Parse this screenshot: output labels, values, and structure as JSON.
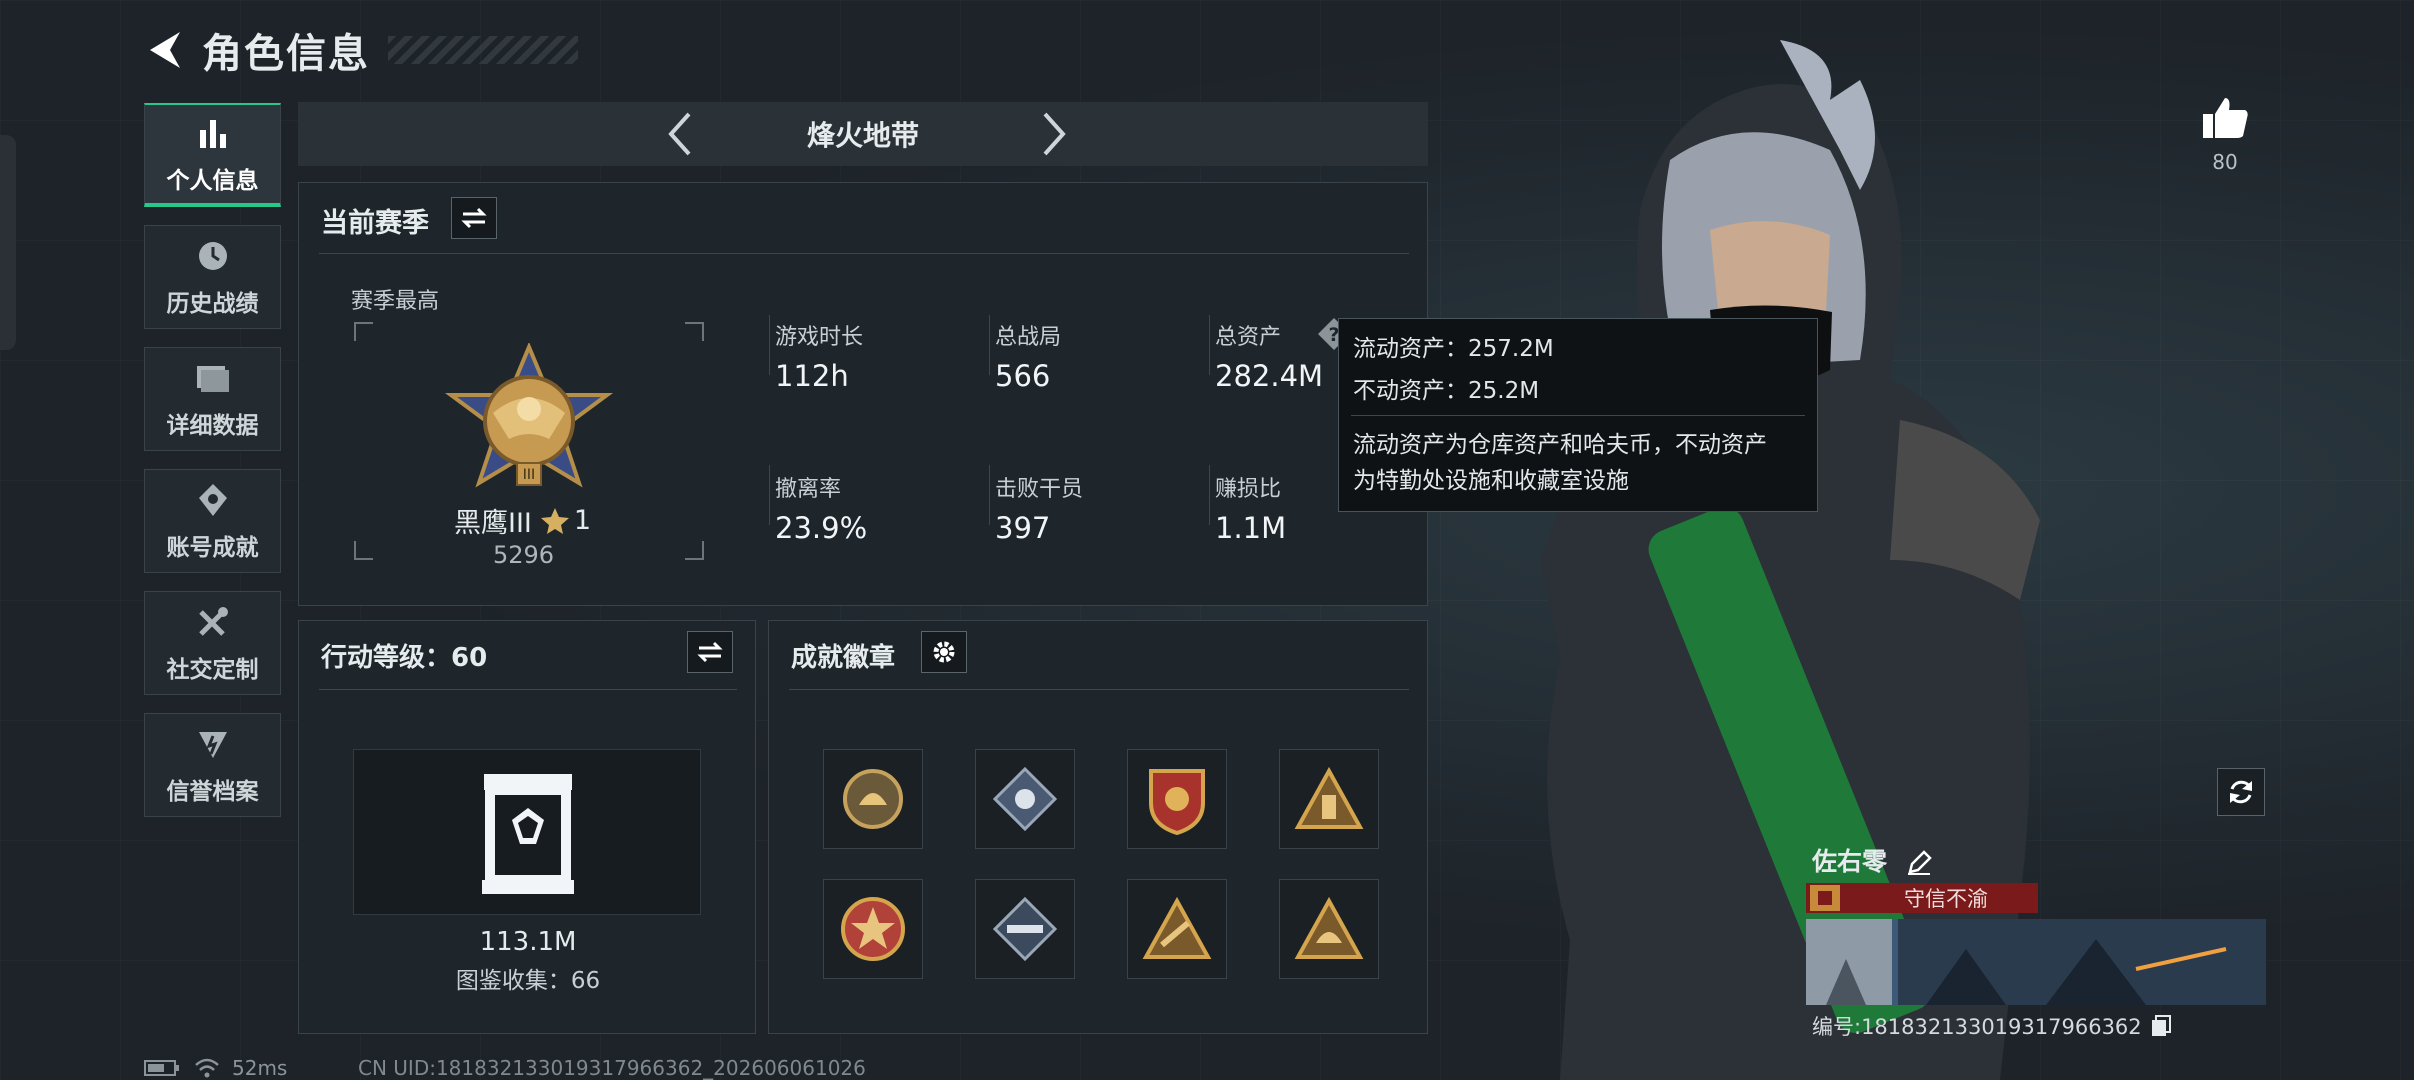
{
  "header": {
    "title": "角色信息"
  },
  "nav": {
    "items": [
      {
        "label": "个人信息",
        "icon": "bar-chart-icon",
        "active": true
      },
      {
        "label": "历史战绩",
        "icon": "clock-icon",
        "active": false
      },
      {
        "label": "详细数据",
        "icon": "folder-icon",
        "active": false
      },
      {
        "label": "账号成就",
        "icon": "achievement-icon",
        "active": false
      },
      {
        "label": "社交定制",
        "icon": "tools-icon",
        "active": false
      },
      {
        "label": "信誉档案",
        "icon": "shield-badge-icon",
        "active": false
      }
    ]
  },
  "mode": {
    "title": "烽火地带"
  },
  "season": {
    "title": "当前赛季",
    "best_label": "赛季最高",
    "rank_name": "黑鹰III",
    "rank_stars": "1",
    "rank_points": "5296",
    "stats": [
      {
        "label": "游戏时长",
        "value": "112h"
      },
      {
        "label": "总战局",
        "value": "566"
      },
      {
        "label": "总资产",
        "value": "282.4M"
      },
      {
        "label": "撤离率",
        "value": "23.9%"
      },
      {
        "label": "击败干员",
        "value": "397"
      },
      {
        "label": "赚损比",
        "value": "1.1M"
      }
    ]
  },
  "tooltip": {
    "liquid": "流动资产：257.2M",
    "fixed": "不动资产：25.2M",
    "desc_line1": "流动资产为仓库资产和哈夫币，不动资产",
    "desc_line2": "为特勤处设施和收藏室设施"
  },
  "level": {
    "title": "行动等级：60",
    "value": "113.1M",
    "collection": "图鉴收集：66"
  },
  "badges": {
    "title": "成就徽章",
    "items": [
      "badge-helmet-icon",
      "badge-flower-icon",
      "badge-shield-icon",
      "badge-soldiers-icon",
      "badge-star-icon",
      "badge-rifle-icon",
      "badge-gun-icon",
      "badge-helmet-triangle-icon"
    ]
  },
  "profile": {
    "likes": "80",
    "name": "佐右零",
    "title": "守信不渝",
    "id": "编号:18183213301931796636​2"
  },
  "status": {
    "ping": "52ms",
    "uid": "CN UID:18183213301931796636​2_202606061026"
  },
  "colors": {
    "accent": "#27c98a",
    "title_bar": "#7a1a1a",
    "rifle_green": "#1f7a3a"
  }
}
